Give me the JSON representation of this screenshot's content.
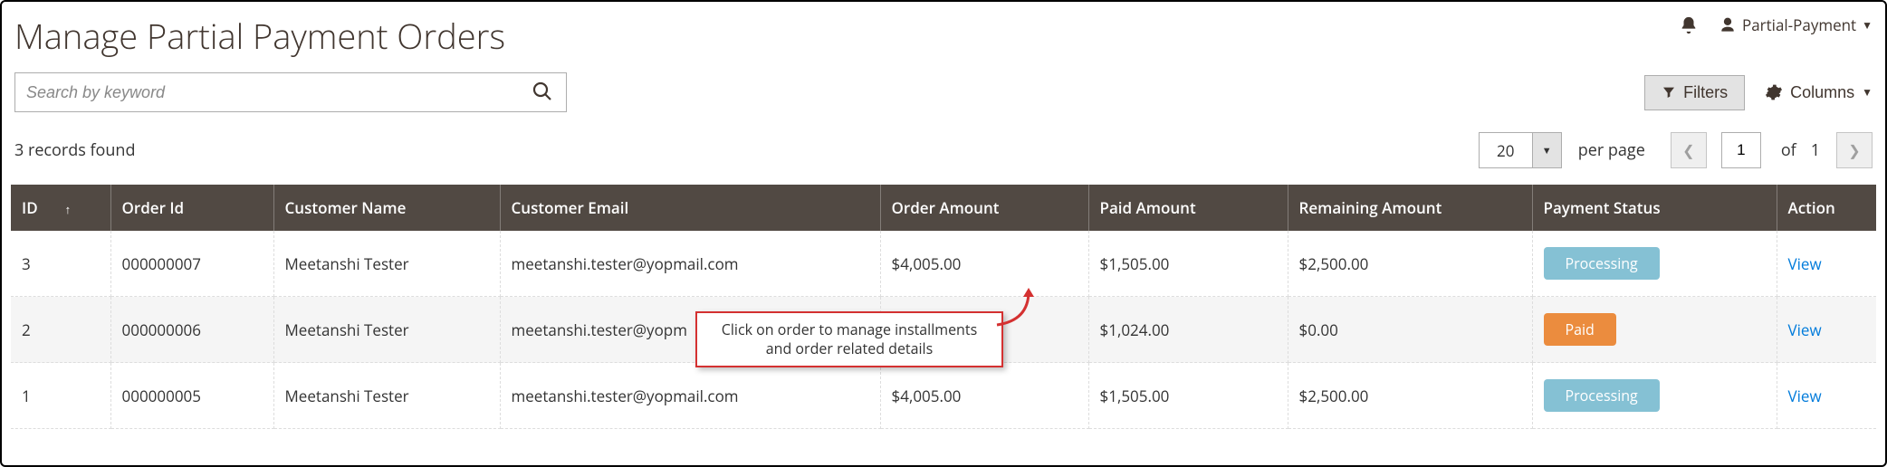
{
  "header": {
    "title": "Manage Partial Payment Orders",
    "account_label": "Partial-Payment"
  },
  "toolbar": {
    "search_placeholder": "Search by keyword",
    "filters_label": "Filters",
    "columns_label": "Columns"
  },
  "meta": {
    "records_found": "3 records found",
    "page_size": "20",
    "per_page_label": "per page",
    "current_page": "1",
    "of_label": "of",
    "total_pages": "1"
  },
  "columns": {
    "id": "ID",
    "order_id": "Order Id",
    "customer_name": "Customer Name",
    "customer_email": "Customer Email",
    "order_amount": "Order Amount",
    "paid_amount": "Paid Amount",
    "remaining_amount": "Remaining Amount",
    "payment_status": "Payment Status",
    "action": "Action"
  },
  "rows": [
    {
      "id": "3",
      "order_id": "000000007",
      "customer_name": "Meetanshi Tester",
      "customer_email": "meetanshi.tester@yopmail.com",
      "order_amount": "$4,005.00",
      "paid_amount": "$1,505.00",
      "remaining_amount": "$2,500.00",
      "payment_status": "Processing",
      "status_class": "status-processing",
      "action": "View"
    },
    {
      "id": "2",
      "order_id": "000000006",
      "customer_name": "Meetanshi Tester",
      "customer_email": "meetanshi.tester@yopm",
      "order_amount": "",
      "paid_amount": "$1,024.00",
      "remaining_amount": "$0.00",
      "payment_status": "Paid",
      "status_class": "status-paid",
      "action": "View"
    },
    {
      "id": "1",
      "order_id": "000000005",
      "customer_name": "Meetanshi Tester",
      "customer_email": "meetanshi.tester@yopmail.com",
      "order_amount": "$4,005.00",
      "paid_amount": "$1,505.00",
      "remaining_amount": "$2,500.00",
      "payment_status": "Processing",
      "status_class": "status-processing",
      "action": "View"
    }
  ],
  "annotation": {
    "text": "Click on order to manage installments and order related details"
  }
}
